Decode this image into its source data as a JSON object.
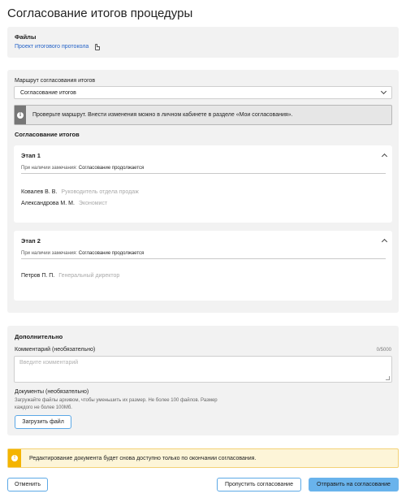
{
  "page": {
    "title": "Согласование итогов процедуры"
  },
  "files": {
    "heading": "Файлы",
    "link": "Проект итогового протокола",
    "icon": "document-icon"
  },
  "route": {
    "label": "Маршрут согласования итогов",
    "select_value": "Согласование итогов",
    "info_text": "Проверьте маршрут. Внести изменения можно в личном кабинете в разделе «Мои согласования».",
    "section_heading": "Согласование итогов"
  },
  "stages": [
    {
      "title": "Этап 1",
      "note_label": "При наличии замечания:",
      "note_value": "Согласование продолжается",
      "people": [
        {
          "name": "Ковалев В. В.",
          "role": "Руководитель отдела продаж"
        },
        {
          "name": "Александрова М. М.",
          "role": "Экономист"
        }
      ]
    },
    {
      "title": "Этап 2",
      "note_label": "При наличии замечания:",
      "note_value": "Согласование продолжается",
      "people": [
        {
          "name": "Петров П. П.",
          "role": "Генеральный директор"
        }
      ]
    }
  ],
  "extra": {
    "heading": "Дополнительно",
    "comment_label": "Комментарий (необязательно)",
    "comment_counter": "0/5000",
    "comment_placeholder": "Введите комментарий",
    "docs_label": "Документы (необязательно)",
    "docs_hint": "Загружайте файлы архивом, чтобы уменьшить их размер. Не более 100 файлов. Размер каждого не более 100Мб.",
    "upload_button": "Загрузить файл"
  },
  "warning": {
    "text": "Редактирование документа будет снова доступно только по окончании согласования."
  },
  "footer": {
    "cancel": "Отменить",
    "skip": "Пропустить согласование",
    "submit": "Отправить на согласование"
  },
  "colors": {
    "accent": "#69b3ec",
    "link": "#2563c7",
    "warning": "#f4b400",
    "panel": "#f2f2f2"
  }
}
